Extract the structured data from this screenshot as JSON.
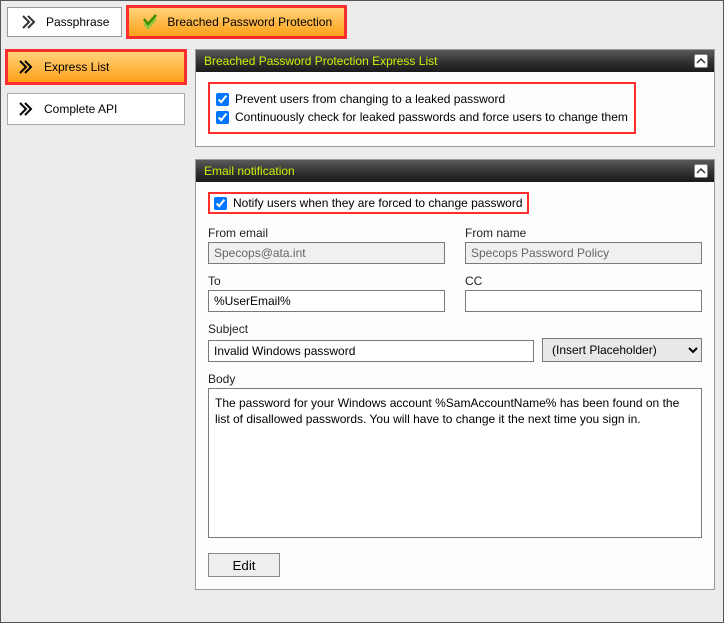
{
  "top_tabs": {
    "passphrase": "Passphrase",
    "breached": "Breached Password Protection"
  },
  "side": {
    "express": "Express List",
    "complete": "Complete API"
  },
  "panel1": {
    "title": "Breached Password Protection Express List",
    "chk1": "Prevent users from changing to a leaked password",
    "chk2": "Continuously check for leaked passwords and force users to change them"
  },
  "panel2": {
    "title": "Email notification",
    "chk_notify": "Notify users when they are forced to change password",
    "labels": {
      "from_email": "From email",
      "from_name": "From name",
      "to": "To",
      "cc": "CC",
      "subject": "Subject",
      "body": "Body"
    },
    "values": {
      "from_email": "Specops@ata.int",
      "from_name": "Specops Password Policy",
      "to": "%UserEmail%",
      "cc": "",
      "subject": "Invalid Windows password",
      "placeholder_select": "(Insert Placeholder)",
      "body": "The password for your Windows account %SamAccountName% has been found on the list of disallowed passwords. You will have to change it the next time you sign in."
    },
    "edit_btn": "Edit"
  }
}
